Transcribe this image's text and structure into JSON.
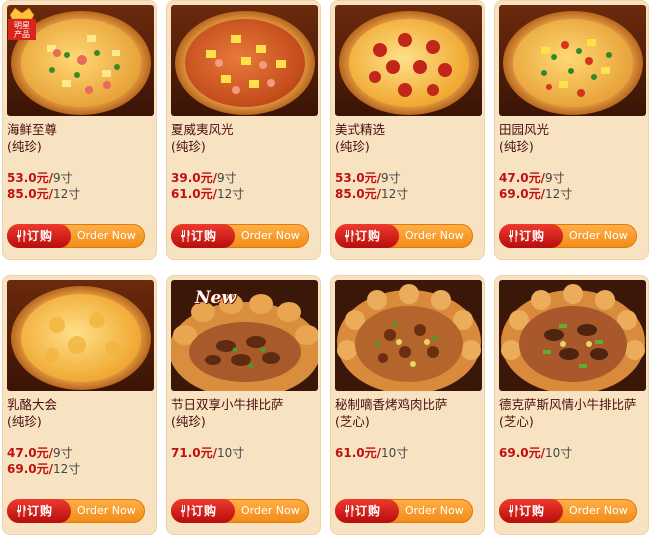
{
  "order_button": {
    "label_cn": "订购",
    "label_en": "Order Now"
  },
  "star_badge": {
    "line1": "明星",
    "line2": "产品"
  },
  "new_badge": "New",
  "products": [
    {
      "name": "海鲜至尊",
      "sub": "(纯珍)",
      "prices": [
        {
          "price": "53.0元/",
          "size": "9寸"
        },
        {
          "price": "85.0元/",
          "size": "12寸"
        }
      ]
    },
    {
      "name": "夏威夷风光",
      "sub": "(纯珍)",
      "prices": [
        {
          "price": "39.0元/",
          "size": "9寸"
        },
        {
          "price": "61.0元/",
          "size": "12寸"
        }
      ]
    },
    {
      "name": "美式精选",
      "sub": "(纯珍)",
      "prices": [
        {
          "price": "53.0元/",
          "size": "9寸"
        },
        {
          "price": "85.0元/",
          "size": "12寸"
        }
      ]
    },
    {
      "name": "田园风光",
      "sub": "(纯珍)",
      "prices": [
        {
          "price": "47.0元/",
          "size": "9寸"
        },
        {
          "price": "69.0元/",
          "size": "12寸"
        }
      ]
    },
    {
      "name": "乳酪大会",
      "sub": "(纯珍)",
      "prices": [
        {
          "price": "47.0元/",
          "size": "9寸"
        },
        {
          "price": "69.0元/",
          "size": "12寸"
        }
      ]
    },
    {
      "name": "节日双享小牛排比萨",
      "sub": "(纯珍)",
      "prices": [
        {
          "price": "71.0元/",
          "size": "10寸"
        }
      ]
    },
    {
      "name": "秘制嘀香烤鸡肉比萨",
      "sub": "(芝心)",
      "prices": [
        {
          "price": "61.0元/",
          "size": "10寸"
        }
      ]
    },
    {
      "name": "德克萨斯风情小牛排比萨",
      "sub": "(芝心)",
      "prices": [
        {
          "price": "69.0元/",
          "size": "10寸"
        }
      ]
    }
  ],
  "colors": {
    "card_bg": "#f7e3c2",
    "price_red": "#c01010",
    "button_red": "#d4231a",
    "button_orange": "#f28a16"
  }
}
